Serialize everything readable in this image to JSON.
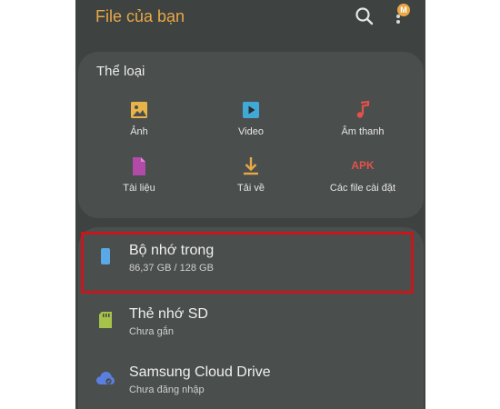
{
  "header": {
    "title": "File của bạn",
    "search_icon": "search-icon",
    "more_icon": "more-vert-icon",
    "badge": "M"
  },
  "categories": {
    "heading": "Thể loại",
    "items": [
      {
        "label": "Ảnh",
        "icon": "image-icon",
        "color": "#e8b44a"
      },
      {
        "label": "Video",
        "icon": "video-play-icon",
        "color": "#41a9d6"
      },
      {
        "label": "Âm thanh",
        "icon": "music-note-icon",
        "color": "#e2524b"
      },
      {
        "label": "Tài liệu",
        "icon": "document-icon",
        "color": "#b24aa8"
      },
      {
        "label": "Tải về",
        "icon": "download-icon",
        "color": "#e8a847"
      },
      {
        "label": "Các file cài đặt",
        "icon": "apk-icon",
        "icon_text": "APK",
        "color": "#e2524b"
      }
    ]
  },
  "storage": [
    {
      "name": "Bộ nhớ trong",
      "detail": "86,37 GB / 128 GB",
      "icon": "phone-storage-icon",
      "color": "#5aa9e6",
      "highlighted": true
    },
    {
      "name": "Thẻ nhớ SD",
      "detail": "Chưa gắn",
      "icon": "sd-card-icon",
      "color": "#a6c24a"
    },
    {
      "name": "Samsung Cloud Drive",
      "detail": "Chưa đăng nhập",
      "icon": "cloud-icon",
      "color": "#5b7fe0"
    }
  ],
  "colors": {
    "accent": "#e8a847",
    "background": "#3e4240",
    "card": "#4a4e4c",
    "highlight_border": "#c8161d"
  }
}
